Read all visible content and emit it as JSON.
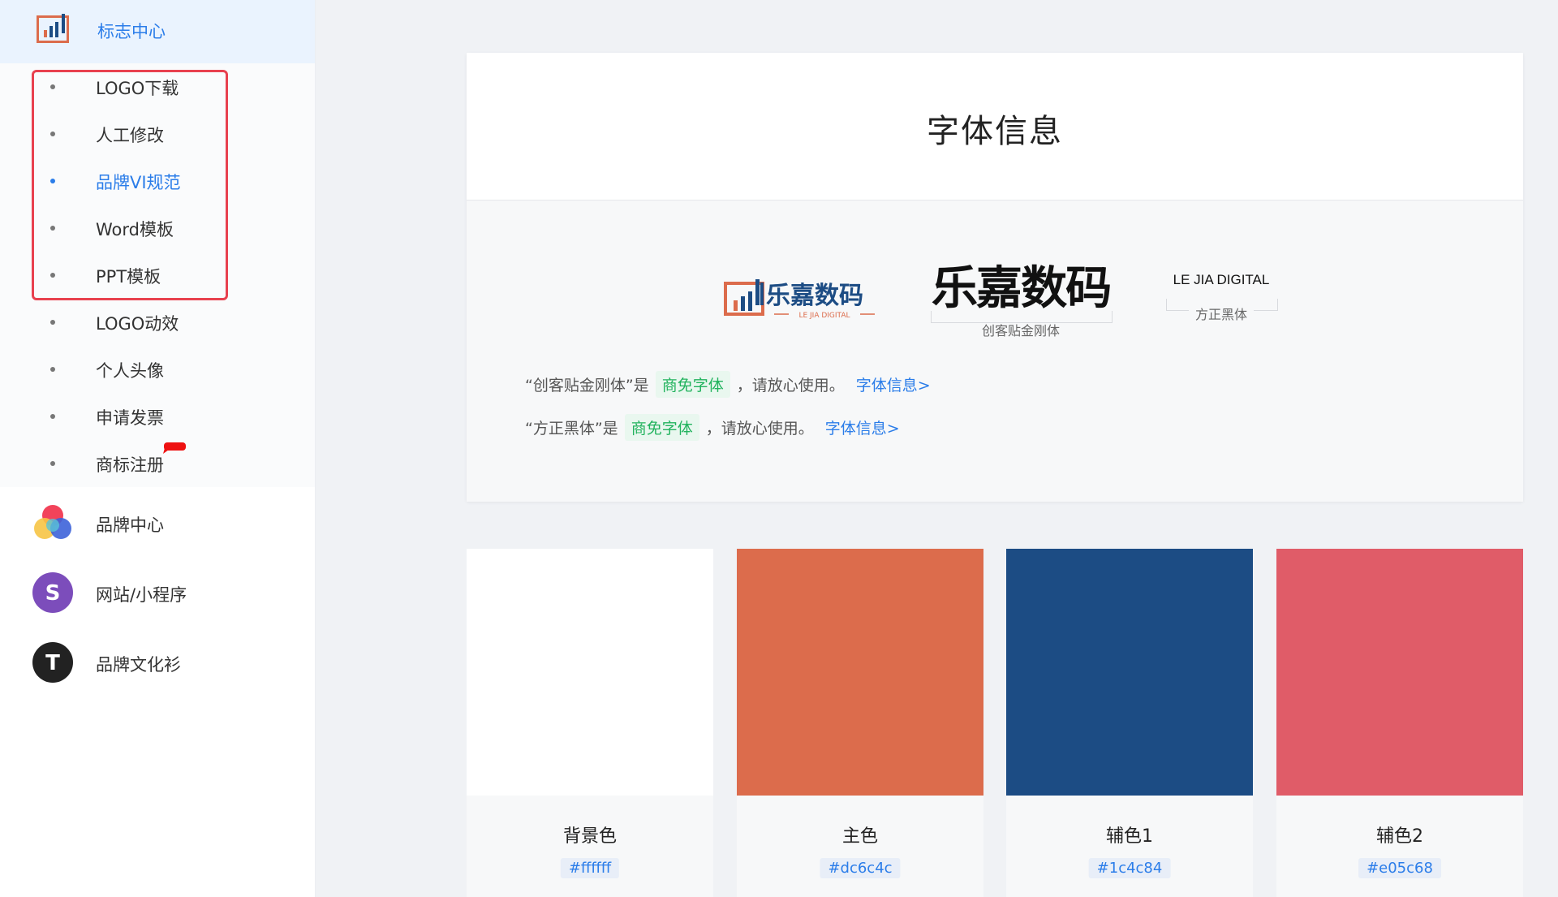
{
  "sidebar": {
    "header": {
      "title": "标志中心",
      "icon": "bar-chart-logo-icon"
    },
    "submenu": [
      {
        "label": "LOGO下载",
        "active": false
      },
      {
        "label": "人工修改",
        "active": false
      },
      {
        "label": "品牌VI规范",
        "active": true
      },
      {
        "label": "Word模板",
        "active": false
      },
      {
        "label": "PPT模板",
        "active": false
      },
      {
        "label": "LOGO动效",
        "active": false
      },
      {
        "label": "个人头像",
        "active": false
      },
      {
        "label": "申请发票",
        "active": false
      },
      {
        "label": "商标注册",
        "active": false
      }
    ],
    "nav": [
      {
        "label": "品牌中心",
        "icon": "color-circles-icon"
      },
      {
        "label": "网站/小程序",
        "icon": "s-circle-icon",
        "letter": "S"
      },
      {
        "label": "品牌文化衫",
        "icon": "t-circle-icon",
        "letter": "T"
      }
    ]
  },
  "font_card": {
    "title": "字体信息",
    "brand_cn": "乐嘉数码",
    "brand_en_small": "LE JIA DIGITAL",
    "display_font_sample": "乐嘉数码",
    "display_font_name": "创客贴金刚体",
    "latin_sample": "LE JIA DIGITAL",
    "latin_font_name": "方正黑体",
    "lines": [
      {
        "prefix": "“创客贴金刚体”是",
        "tag": "商免字体",
        "suffix": "，请放心使用。",
        "link": "字体信息>"
      },
      {
        "prefix": "“方正黑体”是",
        "tag": "商免字体",
        "suffix": "，请放心使用。",
        "link": "字体信息>"
      }
    ]
  },
  "colors": [
    {
      "name": "背景色",
      "hex": "#ffffff"
    },
    {
      "name": "主色",
      "hex": "#dc6c4c"
    },
    {
      "name": "辅色1",
      "hex": "#1c4c84"
    },
    {
      "name": "辅色2",
      "hex": "#e05c68"
    }
  ],
  "theme": {
    "accent": "#2b7de9",
    "highlight_border": "#e8414f",
    "tag_green": "#22b35e"
  }
}
